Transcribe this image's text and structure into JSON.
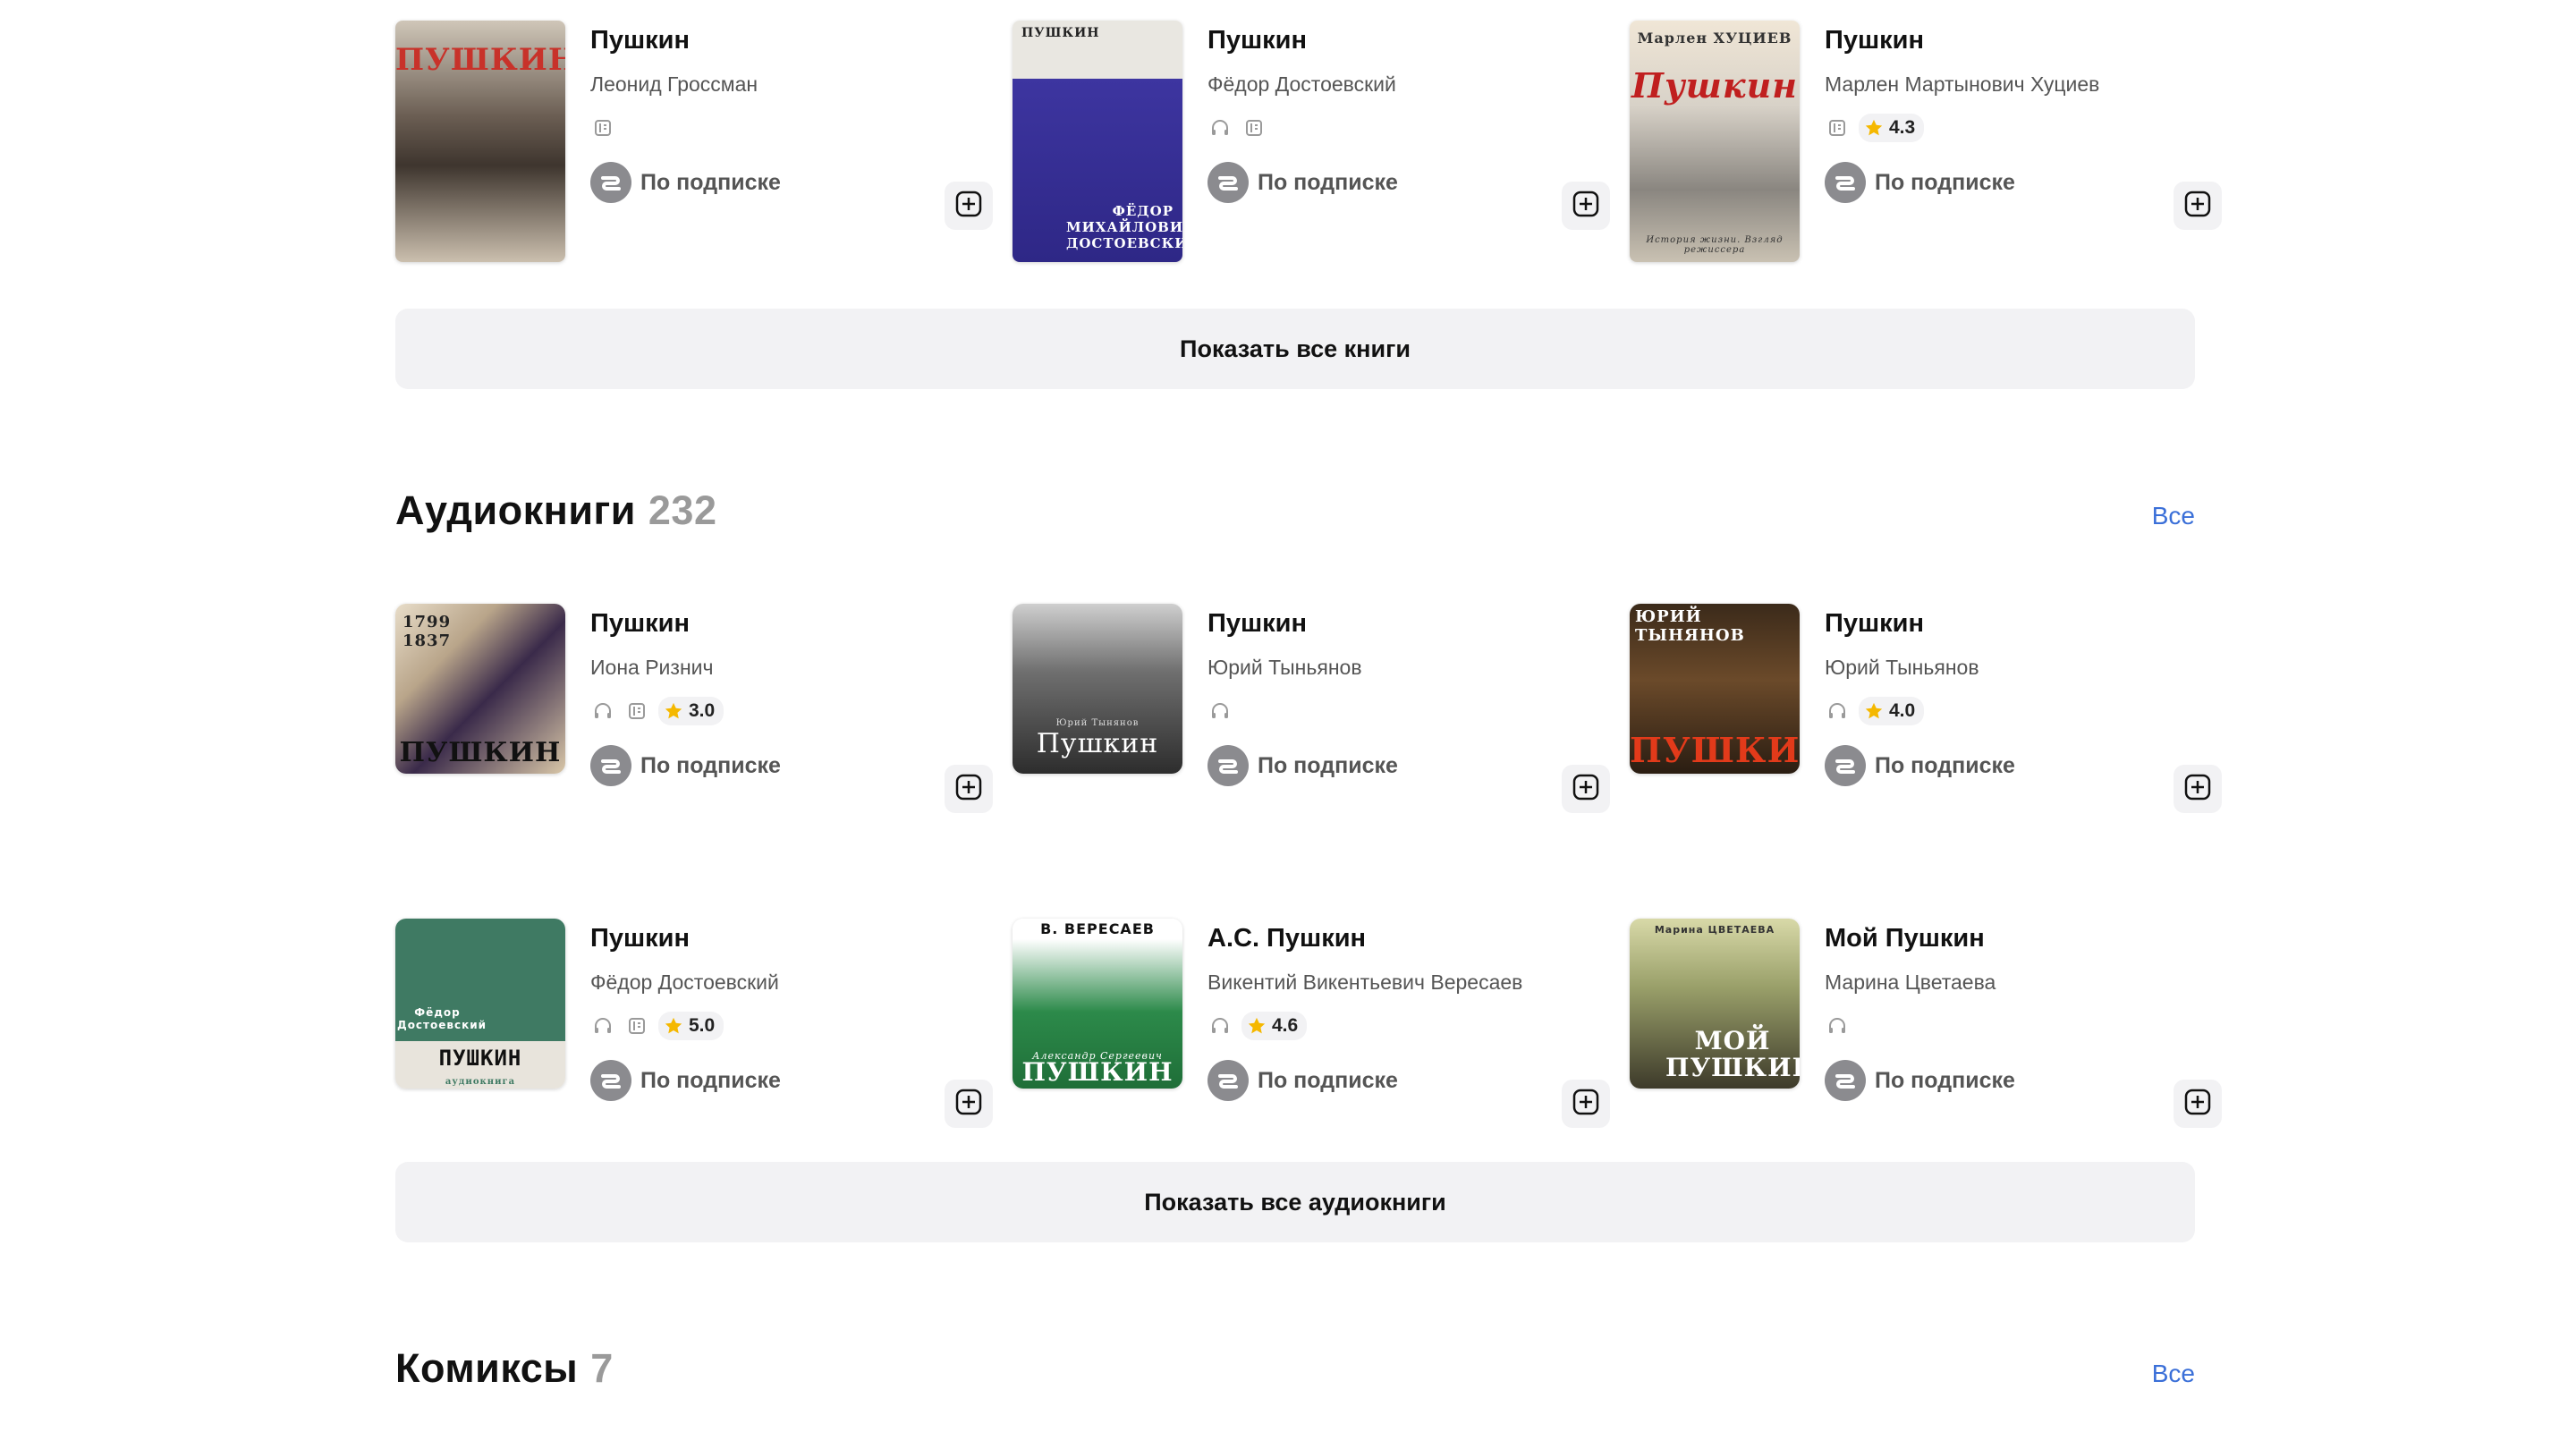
{
  "books_top": [
    {
      "title": "Пушкин",
      "author": "Леонид Гроссман",
      "formats": [
        "book"
      ],
      "rating": "",
      "access": "По подписке",
      "cover_text": "ПУШКИН",
      "cover_top": "",
      "cover_bottom": ""
    },
    {
      "title": "Пушкин",
      "author": "Фёдор Достоевский",
      "formats": [
        "audio",
        "book"
      ],
      "rating": "",
      "access": "По подписке",
      "cover_text": "ПУШКИН",
      "cover_top": "",
      "cover_bottom": "ФЁДОР МИХАЙЛОВИЧ ДОСТОЕВСКИЙ"
    },
    {
      "title": "Пушкин",
      "author": "Марлен Мартынович Хуциев",
      "formats": [
        "book"
      ],
      "rating": "4.3",
      "access": "По подписке",
      "cover_text": "Пушкин",
      "cover_top": "Марлен ХУЦИЕВ",
      "cover_bottom": "История жизни. Взгляд режиссера"
    }
  ],
  "show_all_books": "Показать все книги",
  "audiobooks": {
    "title": "Аудиокниги",
    "count": "232",
    "all_link": "Все",
    "items": [
      {
        "title": "Пушкин",
        "author": "Иона Ризнич",
        "formats": [
          "audio",
          "book"
        ],
        "rating": "3.0",
        "access": "По подписке",
        "cover_text": "ПУШКИН",
        "cover_top": "1799 1837",
        "cover_bottom": ""
      },
      {
        "title": "Пушкин",
        "author": "Юрий Тыньянов",
        "formats": [
          "audio"
        ],
        "rating": "",
        "access": "По подписке",
        "cover_text": "Пушкин",
        "cover_top": "Юрий Тынянов",
        "cover_bottom": ""
      },
      {
        "title": "Пушкин",
        "author": "Юрий Тыньянов",
        "formats": [
          "audio"
        ],
        "rating": "4.0",
        "access": "По подписке",
        "cover_text": "ПУШКИН",
        "cover_top": "ЮРИЙ ТЫНЯНОВ",
        "cover_bottom": ""
      },
      {
        "title": "Пушкин",
        "author": "Фёдор Достоевский",
        "formats": [
          "audio",
          "book"
        ],
        "rating": "5.0",
        "access": "По подписке",
        "cover_text": "ПУШКИН",
        "cover_top": "Фёдор Достоевский",
        "cover_bottom": "аудиокнига"
      },
      {
        "title": "А.С. Пушкин",
        "author": "Викентий Викентьевич Вересаев",
        "formats": [
          "audio"
        ],
        "rating": "4.6",
        "access": "По подписке",
        "cover_text": "ПУШКИН",
        "cover_top": "В. ВЕРЕСАЕВ",
        "cover_bottom": "Александр Сергеевич"
      },
      {
        "title": "Мой Пушкин",
        "author": "Марина Цветаева",
        "formats": [
          "audio"
        ],
        "rating": "",
        "access": "По подписке",
        "cover_text": "МОЙ ПУШКИН",
        "cover_top": "Марина ЦВЕТАЕВА",
        "cover_bottom": ""
      }
    ]
  },
  "show_all_audiobooks": "Показать все аудиокниги",
  "comics": {
    "title": "Комиксы",
    "count": "7",
    "all_link": "Все"
  },
  "colors": {
    "accent": "#3a6fd8",
    "muted": "#8b8b8f",
    "button_bg": "#f2f2f4",
    "star": "#f5b800"
  },
  "icons": {
    "audio": "headphones-icon",
    "book": "book-icon",
    "rating": "star-icon",
    "subscription": "subscription-icon",
    "add": "add-icon"
  }
}
